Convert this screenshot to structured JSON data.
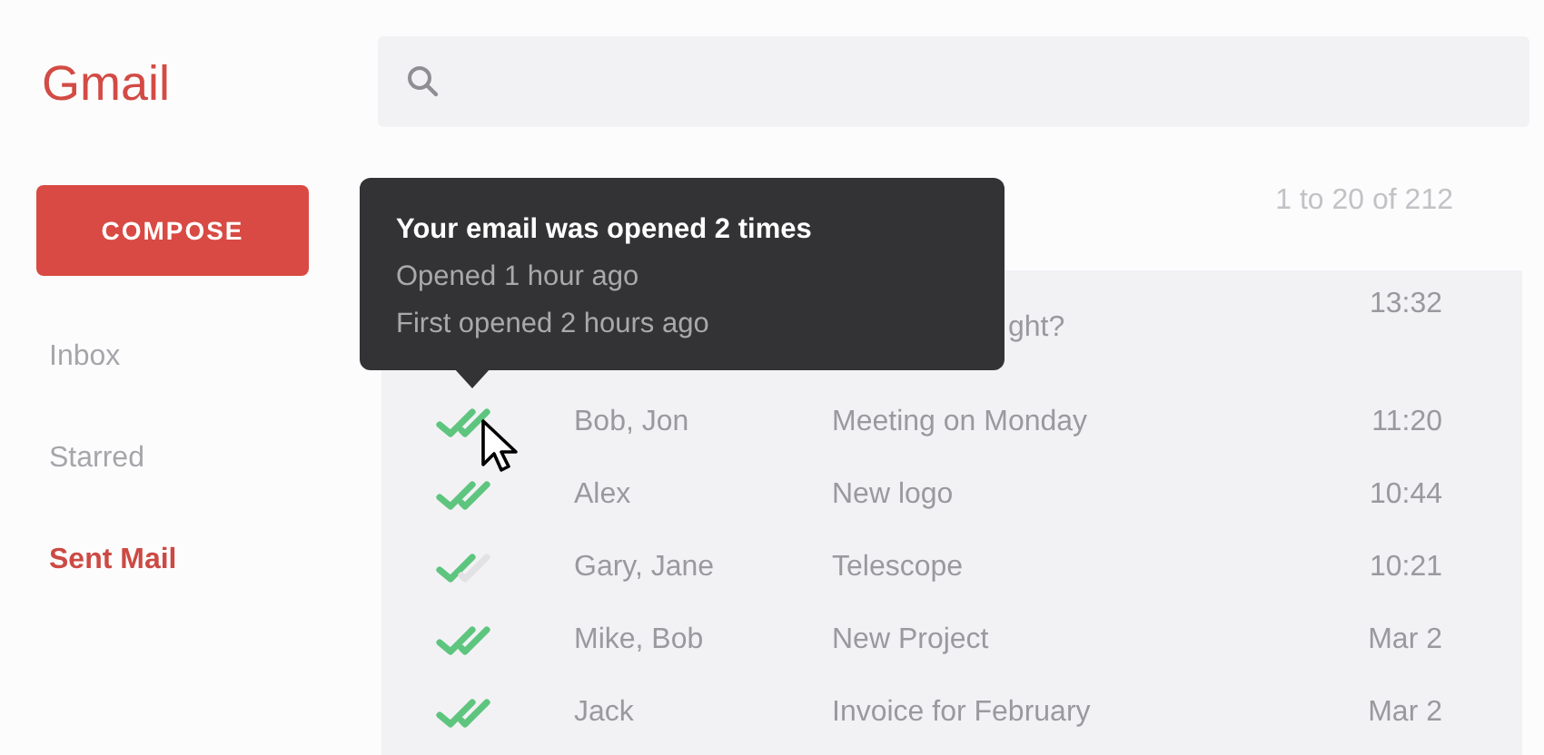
{
  "sidebar": {
    "logo": "Gmail",
    "compose": "COMPOSE",
    "items": [
      {
        "label": "Inbox",
        "selected": false
      },
      {
        "label": "Starred",
        "selected": false
      },
      {
        "label": "Sent Mail",
        "selected": true
      }
    ]
  },
  "pagination": "1 to 20 of 212",
  "tooltip": {
    "title": "Your email was opened 2 times",
    "lines": [
      "Opened 1 hour ago",
      "First opened 2 hours ago"
    ]
  },
  "emails": [
    {
      "kind": "covered",
      "subject": "ght?",
      "time": "13:32"
    },
    {
      "kind": "full",
      "opened_twice": true,
      "recipients": "Bob, Jon",
      "subject": "Meeting on Monday",
      "time": "11:20"
    },
    {
      "kind": "full",
      "opened_twice": true,
      "recipients": "Alex",
      "subject": "New logo",
      "time": "10:44"
    },
    {
      "kind": "full",
      "opened_twice": false,
      "recipients": "Gary, Jane",
      "subject": "Telescope",
      "time": "10:21"
    },
    {
      "kind": "full",
      "opened_twice": true,
      "recipients": "Mike, Bob",
      "subject": "New Project",
      "time": "Mar 2"
    },
    {
      "kind": "full",
      "opened_twice": true,
      "recipients": "Jack",
      "subject": "Invoice for February",
      "time": "Mar 2"
    }
  ]
}
